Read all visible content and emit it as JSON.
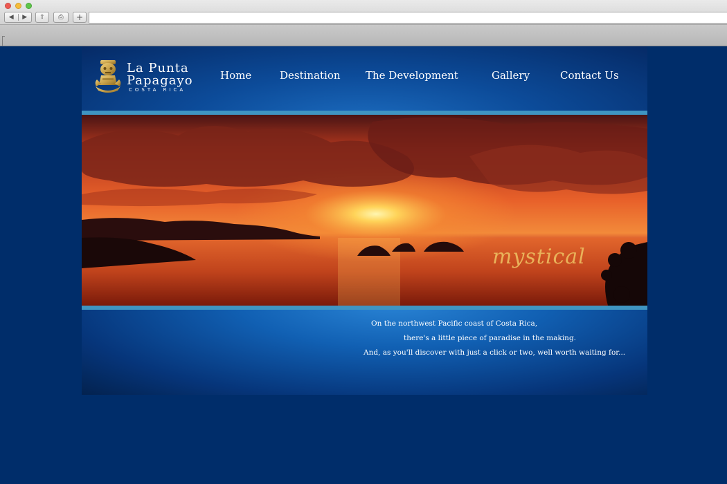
{
  "browser": {
    "back_label": "◀",
    "forward_label": "▶",
    "share_label": "⇪",
    "print_label": "⎙",
    "newtab_label": "+",
    "url": ""
  },
  "logo": {
    "line1": "La Punta",
    "line2": "Papagayo",
    "line3": "COSTA RICA",
    "figure_color": "#c9a24b"
  },
  "nav": {
    "items": [
      {
        "label": "Home"
      },
      {
        "label": "Destination"
      },
      {
        "label": "The Development"
      },
      {
        "label": "Gallery"
      },
      {
        "label": "Contact Us"
      }
    ]
  },
  "hero": {
    "word": "mystical"
  },
  "intro": {
    "line1": "On the northwest Pacific coast of Costa Rica,",
    "line2": "there's a little piece of paradise in the making.",
    "line3": "And, as you'll discover with just a click or two, well worth waiting for..."
  },
  "colors": {
    "page_bg": "#002d6a",
    "stripe": "#3f95c2",
    "accent_gold": "#e9b25a"
  }
}
